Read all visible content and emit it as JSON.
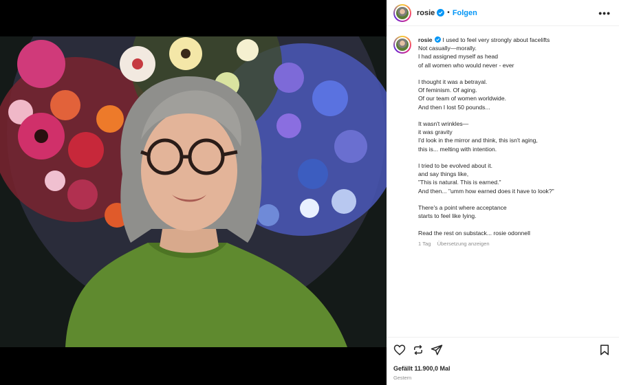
{
  "post": {
    "username": "rosie",
    "separator": "•",
    "follow_label": "Folgen",
    "more_label": "•••"
  },
  "caption": {
    "username": "rosie",
    "lines": [
      "I used to feel very strongly about facelifts",
      "Not casually—morally.",
      "I had assigned myself as head",
      "of all women who would never - ever",
      "",
      "I thought it was a betrayal.",
      "Of feminism. Of aging.",
      "Of our team of women worldwide.",
      "And then I lost 50 pounds...",
      "",
      "It wasn't wrinkles—",
      "it was gravity",
      "I'd look in the mirror and think, this isn't aging,",
      "this is... melting with intention.",
      "",
      "I tried to be evolved about it.",
      "and say things like,",
      "\"This is natural. This is earned.\"",
      "And then... \"umm how earned does it have to look?\"",
      "",
      "There's a point where acceptance",
      "starts to feel like lying.",
      "",
      "Read the rest on substack... rosie odonnell"
    ],
    "age": "1 Tag",
    "translate_label": "Übersetzung anzeigen"
  },
  "footer": {
    "likes_text": "Gefällt 11.900,0 Mal",
    "date_text": "Gestern"
  },
  "icons": {
    "like": "heart-icon",
    "repost": "repost-icon",
    "share": "paper-plane-icon",
    "save": "bookmark-icon",
    "verified": "verified-badge-icon"
  },
  "colors": {
    "link_blue": "#0095f6",
    "verified_blue": "#0095f6",
    "text_primary": "#262626",
    "text_secondary": "#8e8e8e",
    "sweater_green": "#5f8a2f"
  }
}
